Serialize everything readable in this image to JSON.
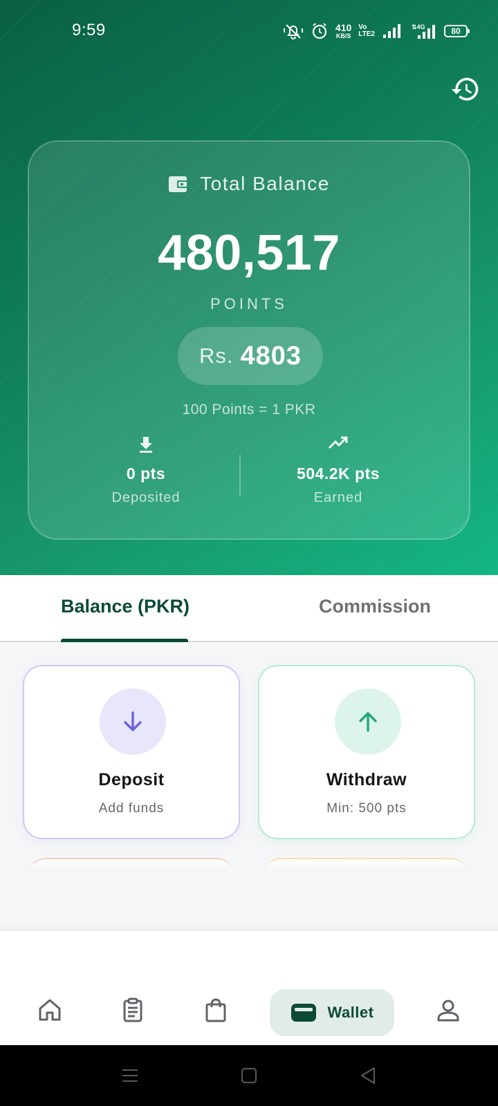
{
  "status_bar": {
    "time": "9:59",
    "net_speed_value": "410",
    "net_speed_unit": "KB/S",
    "volte_top": "Vo",
    "volte_bottom": "LTE2",
    "network_type": "4G",
    "battery": "80"
  },
  "balance_card": {
    "title": "Total Balance",
    "points": "480,517",
    "points_label": "POINTS",
    "pkr_prefix": "Rs.",
    "pkr_amount": "4803",
    "rate": "100 Points = 1 PKR",
    "deposited_value": "0 pts",
    "deposited_label": "Deposited",
    "earned_value": "504.2K pts",
    "earned_label": "Earned"
  },
  "tabs": [
    {
      "label": "Balance (PKR)",
      "active": true
    },
    {
      "label": "Commission",
      "active": false
    }
  ],
  "actions": {
    "deposit": {
      "title": "Deposit",
      "subtitle": "Add funds",
      "accent": "#6b63dc"
    },
    "withdraw": {
      "title": "Withdraw",
      "subtitle": "Min: 500 pts",
      "accent": "#1fa876"
    }
  },
  "bottom_nav": {
    "items": [
      "home-icon",
      "orders-icon",
      "shopping-bag-icon",
      "wallet-icon",
      "profile-icon"
    ],
    "active_label": "Wallet"
  },
  "colors": {
    "primary_dark": "#0b4a37",
    "header_gradient_start": "#0a5f44",
    "header_gradient_end": "#14b585"
  }
}
